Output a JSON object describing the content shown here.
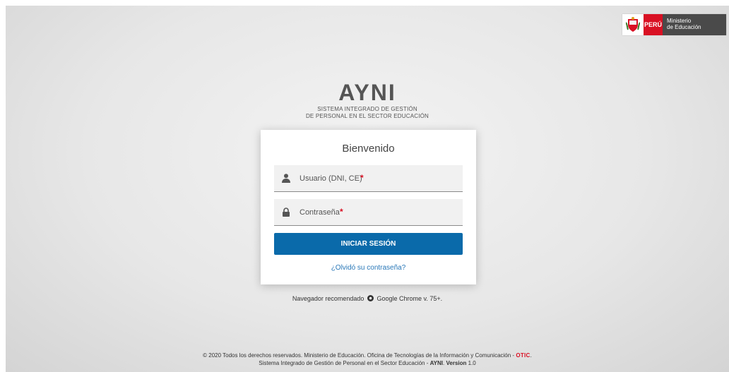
{
  "gov": {
    "country": "PERÚ",
    "ministry_line1": "Ministerio",
    "ministry_line2": "de Educación"
  },
  "brand": {
    "title": "AYNI",
    "subtitle_line1": "SISTEMA INTEGRADO DE GESTIÓN",
    "subtitle_line2": "DE PERSONAL EN EL SECTOR EDUCACIÓN"
  },
  "login": {
    "title": "Bienvenido",
    "username_placeholder": "Usuario (DNI, CE)",
    "password_placeholder": "Contraseña",
    "required_mark": "*",
    "submit_label": "INICIAR SESIÓN",
    "forgot_label": "¿Olvidó su contraseña?"
  },
  "browser_note": {
    "prefix": "Navegador recomendado",
    "browser": "Google Chrome v. 75+."
  },
  "footer": {
    "line1": "© 2020 Todos los derechos reservados. Ministerio de Educación. Oficina de Tecnologías de la Información y Comunicación -",
    "office": "OTIC",
    "line1_end": ".",
    "line2_prefix": "Sistema Integrado de Gestión de Personal en el Sector Educación -",
    "app": "AYNI",
    "version_label": "Version",
    "version": "1.0"
  },
  "colors": {
    "primary": "#0a6aaa",
    "required": "#d91023",
    "link": "#2a78b8"
  },
  "icons": [
    "coat-of-arms-icon",
    "user-icon",
    "lock-icon",
    "chrome-icon"
  ]
}
